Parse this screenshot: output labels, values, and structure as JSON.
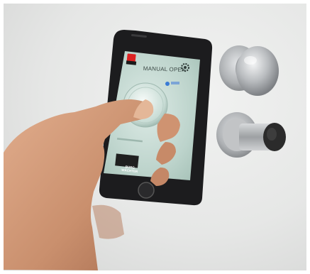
{
  "photo": {
    "app_title": "MANUAL OPEN",
    "logo_text": "BURG WÄCHTER",
    "colors": {
      "wall": "#e6e7e6",
      "phone_body": "#1c1c1e",
      "screen_bg": "#cfe2dc",
      "skin": "#d29a78",
      "chrome": "#b6b8ba",
      "cylinder_cap": "#2b2b2b"
    },
    "icons": [
      "settings-gear-icon",
      "app-logo-icon"
    ]
  }
}
